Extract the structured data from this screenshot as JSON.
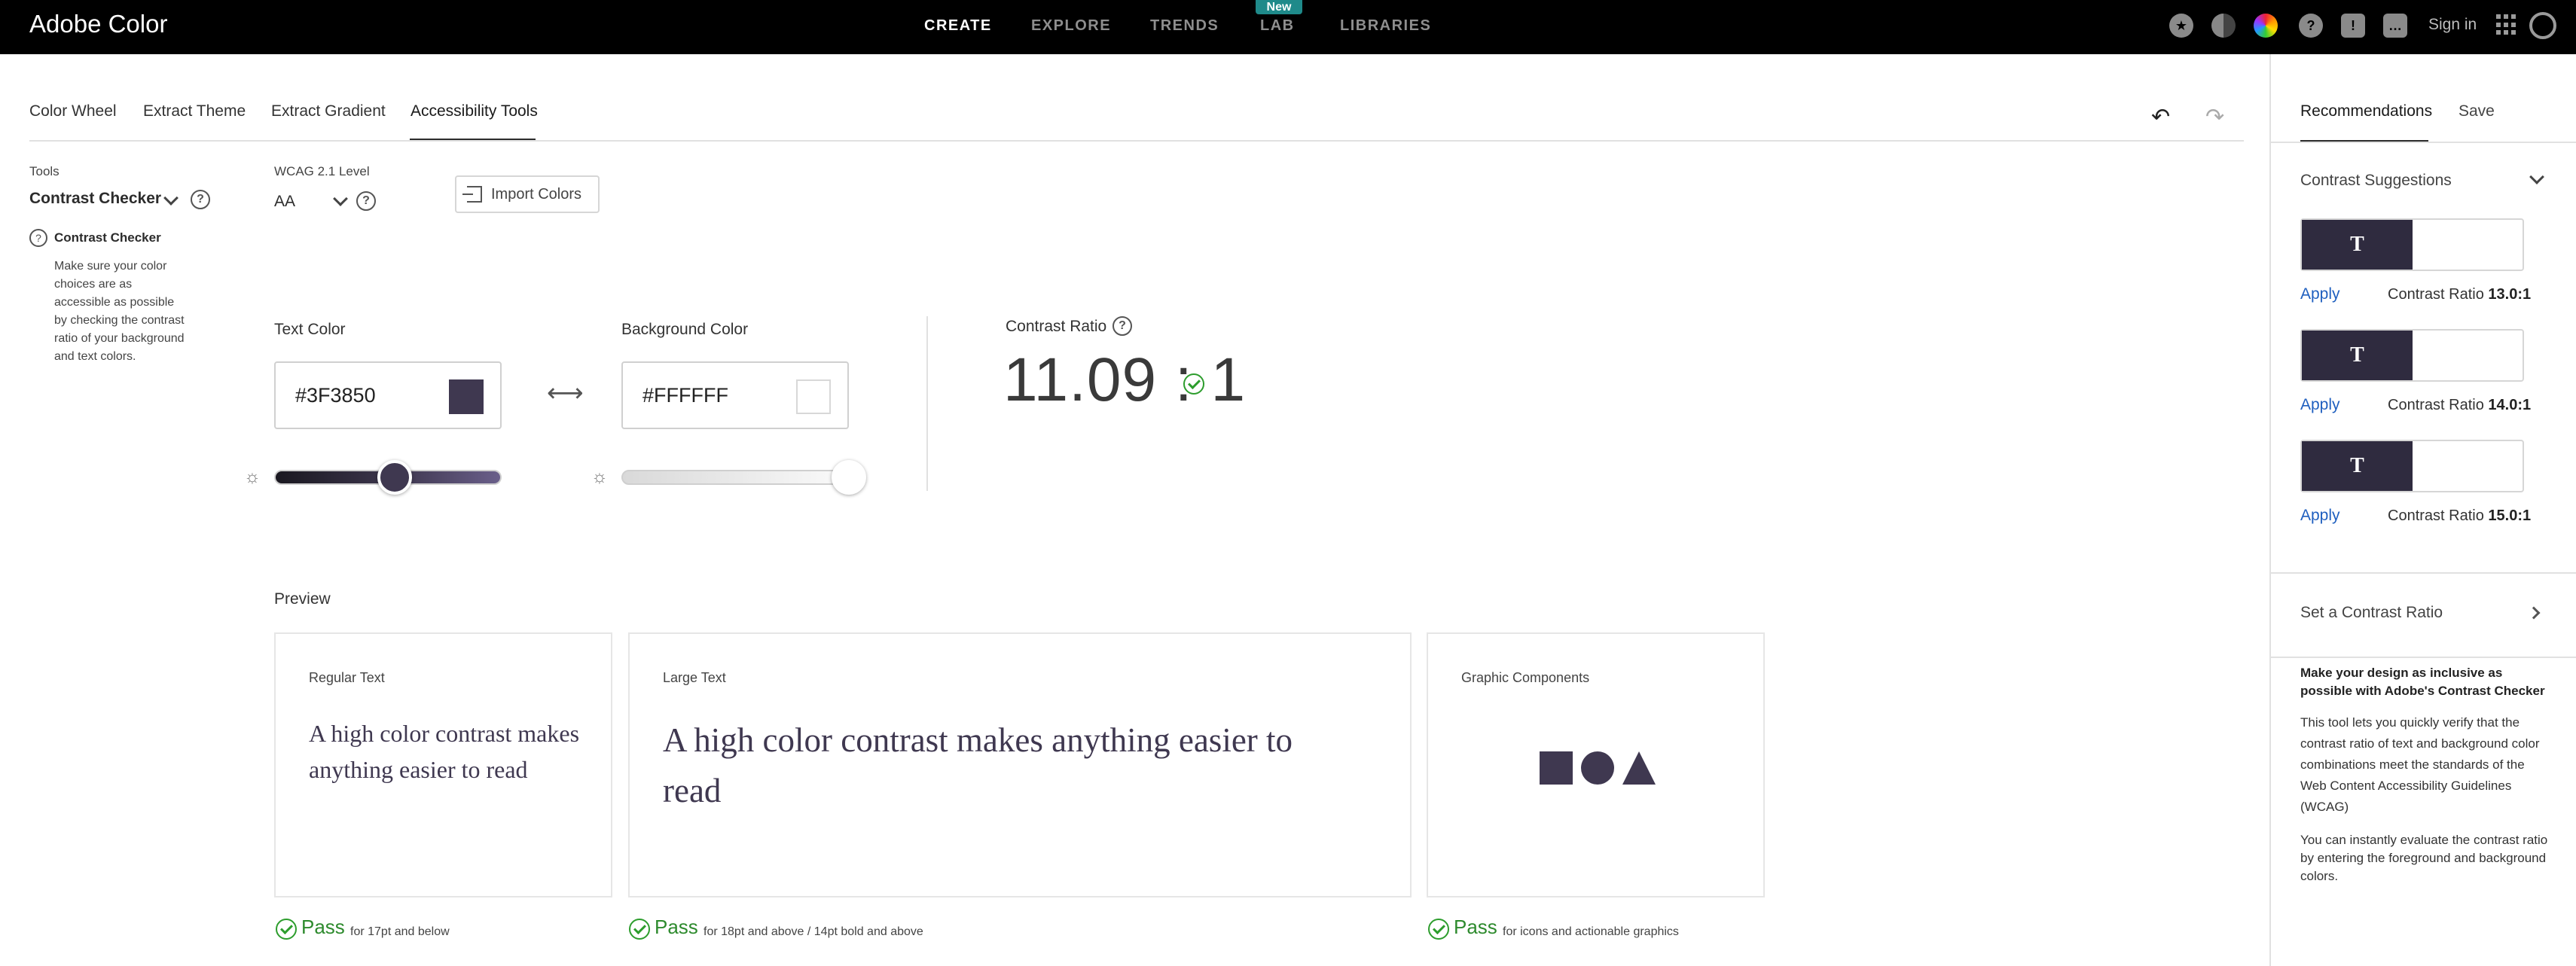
{
  "app": {
    "brand": "Adobe Color"
  },
  "topnav": {
    "items": [
      "CREATE",
      "EXPLORE",
      "TRENDS",
      "LAB",
      "LIBRARIES"
    ],
    "active": "CREATE",
    "lab_badge": "New",
    "signin": "Sign in",
    "icons": [
      "star-icon",
      "contrast-icon",
      "color-wheel-icon",
      "help-icon",
      "alert-icon",
      "chat-icon",
      "apps-grid-icon",
      "creative-cloud-icon"
    ]
  },
  "tabs": {
    "items": [
      "Color Wheel",
      "Extract Theme",
      "Extract Gradient",
      "Accessibility Tools"
    ],
    "active": "Accessibility Tools"
  },
  "tools": {
    "label": "Tools",
    "value": "Contrast Checker",
    "info_title": "Contrast Checker",
    "info_desc": "Make sure your color choices are as accessible as possible by checking the contrast ratio of your background and text colors."
  },
  "wcag": {
    "label": "WCAG 2.1 Level",
    "value": "AA"
  },
  "import_button": "Import Colors",
  "text_color": {
    "label": "Text Color",
    "value": "#3F3850",
    "swatch": "#3F3850",
    "brightness": 0.53
  },
  "background_color": {
    "label": "Background Color",
    "value": "#FFFFFF",
    "swatch": "#FFFFFF",
    "brightness": 1.0
  },
  "contrast": {
    "label": "Contrast Ratio",
    "value": "11.09 : 1"
  },
  "preview": {
    "label": "Preview",
    "cards": [
      {
        "title": "Regular Text",
        "text": "A high color contrast makes anything easier to read",
        "pass": "Pass",
        "note": "for 17pt and below"
      },
      {
        "title": "Large Text",
        "text": "A high color contrast makes anything easier to read",
        "pass": "Pass",
        "note": "for 18pt and above / 14pt bold and above"
      },
      {
        "title": "Graphic Components",
        "shapes": [
          "square-icon",
          "circle-icon",
          "triangle-icon"
        ],
        "pass": "Pass",
        "note": "for icons and actionable graphics"
      }
    ]
  },
  "right_panel": {
    "tabs": [
      "Recommendations",
      "Save"
    ],
    "active_tab": "Recommendations",
    "suggestions_label": "Contrast Suggestions",
    "suggestions": [
      {
        "glyph": "T",
        "apply": "Apply",
        "ratio_label": "Contrast Ratio",
        "ratio": "13.0:1"
      },
      {
        "glyph": "T",
        "apply": "Apply",
        "ratio_label": "Contrast Ratio",
        "ratio": "14.0:1"
      },
      {
        "glyph": "T",
        "apply": "Apply",
        "ratio_label": "Contrast Ratio",
        "ratio": "15.0:1"
      }
    ],
    "set_ratio": "Set a Contrast Ratio",
    "promo_title": "Make your design as inclusive as possible with Adobe's Contrast Checker",
    "promo_p1": "This tool lets you quickly verify that the contrast ratio of text and background color combinations meet the standards of the Web Content Accessibility Guidelines (WCAG)",
    "promo_p2": "You can instantly evaluate the contrast ratio by entering the foreground and background colors."
  },
  "colors": {
    "accent": "#2C2C2C",
    "pass": "#2D8A2D",
    "link": "#1F5FBF",
    "suggestion_dark": "#2F2B3F"
  }
}
